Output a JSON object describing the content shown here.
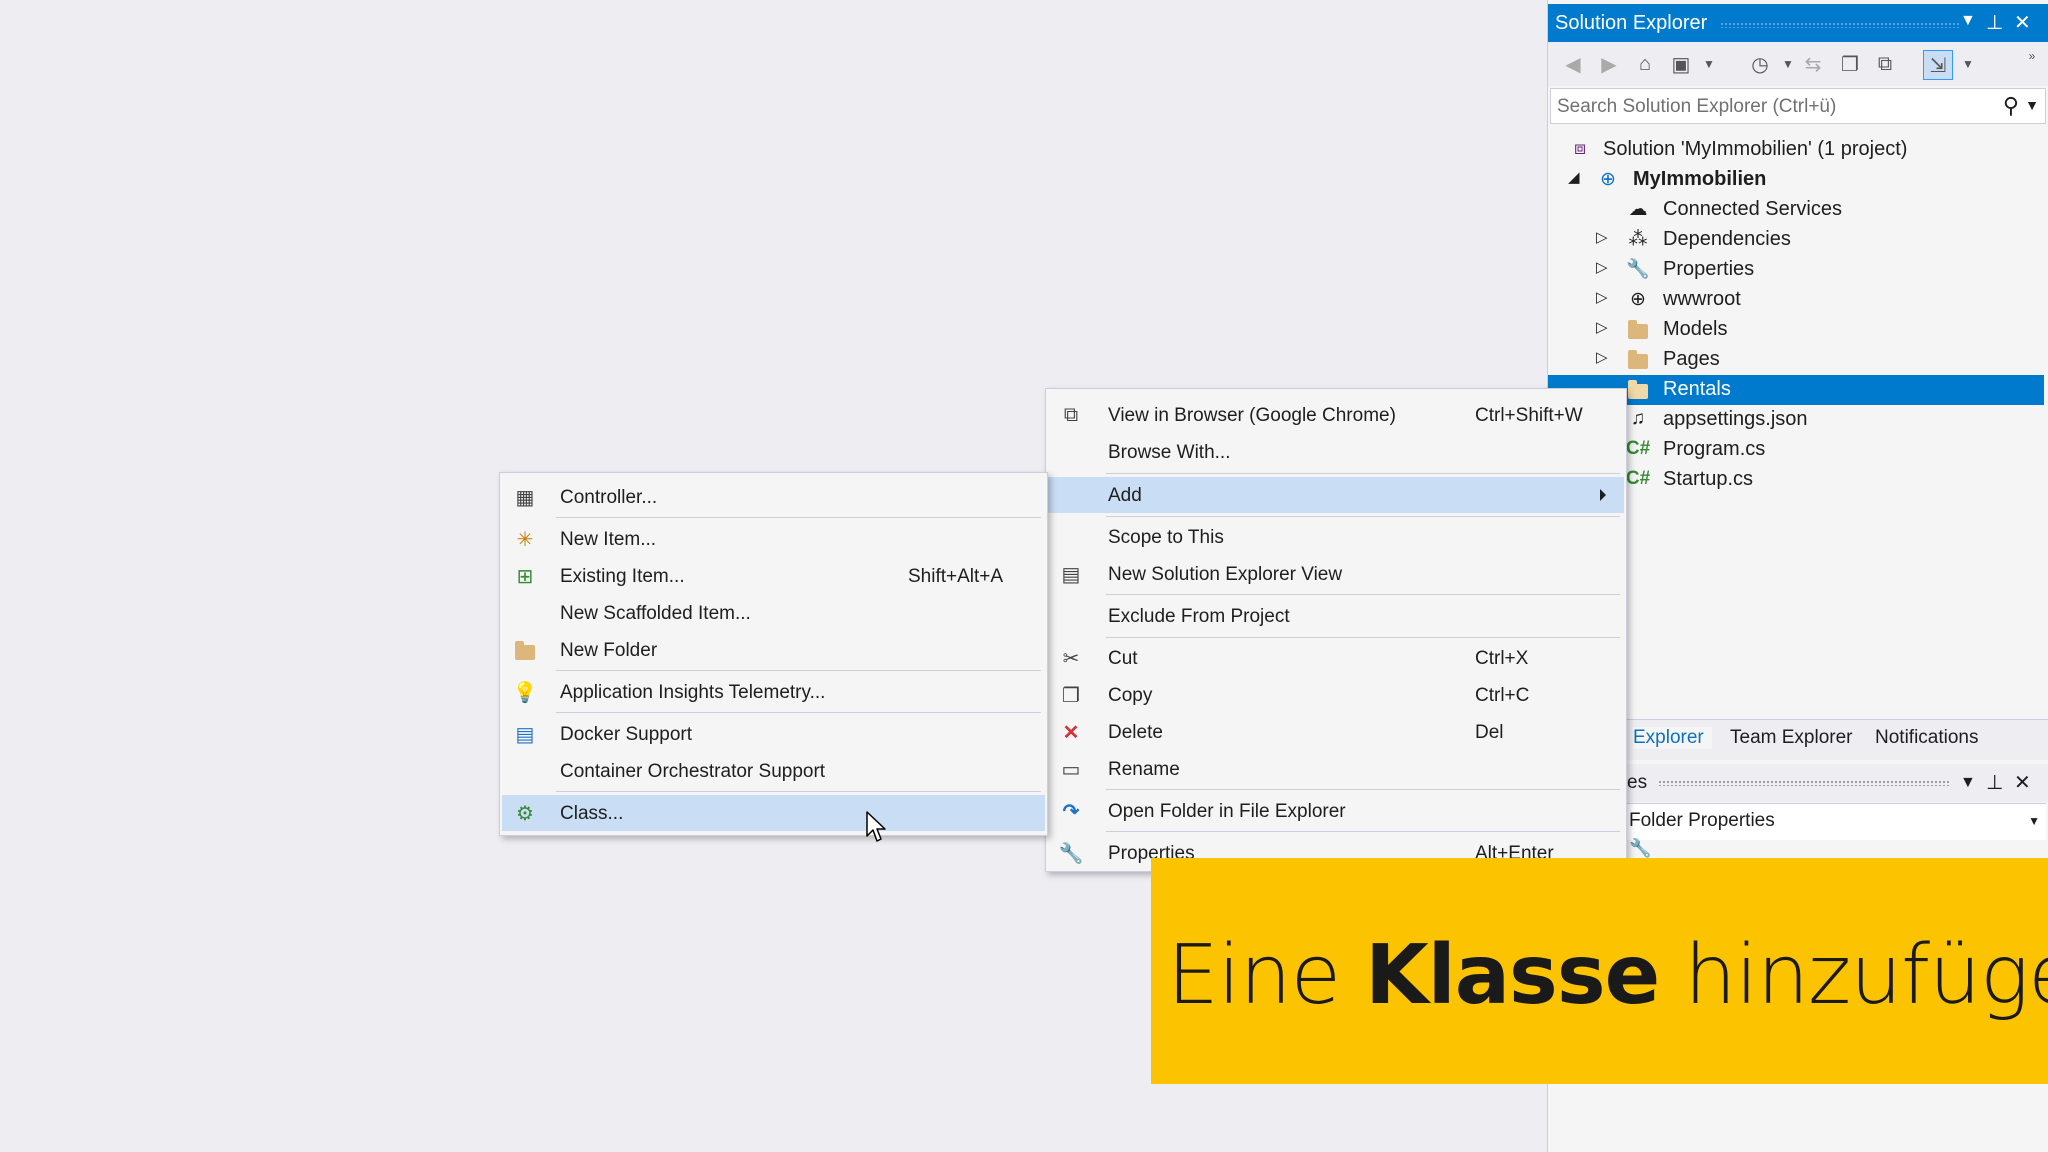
{
  "solution_explorer": {
    "title": "Solution Explorer",
    "search_placeholder": "Search Solution Explorer (Ctrl+ü)",
    "tree": [
      {
        "label": "Solution 'MyImmobilien' (1 project)",
        "icon": "solution-icon"
      },
      {
        "label": "MyImmobilien",
        "icon": "web-project-icon",
        "bold": true,
        "expanded": true
      },
      {
        "label": "Connected Services",
        "icon": "connected-services-icon"
      },
      {
        "label": "Dependencies",
        "icon": "dependencies-icon"
      },
      {
        "label": "Properties",
        "icon": "wrench-icon"
      },
      {
        "label": "wwwroot",
        "icon": "globe-icon"
      },
      {
        "label": "Models",
        "icon": "folder-icon"
      },
      {
        "label": "Pages",
        "icon": "folder-icon"
      },
      {
        "label": "Rentals",
        "icon": "folder-icon",
        "selected": true
      },
      {
        "label": "appsettings.json",
        "icon": "json-icon"
      },
      {
        "label": "Program.cs",
        "icon": "csharp-icon"
      },
      {
        "label": "Startup.cs",
        "icon": "csharp-icon"
      }
    ],
    "tabs": [
      "Explorer",
      "Team Explorer",
      "Notifications"
    ],
    "properties_title_fragment": "es",
    "properties_combo": "Folder Properties"
  },
  "context_menu": {
    "items": [
      {
        "label": "View in Browser (Google Chrome)",
        "shortcut": "Ctrl+Shift+W",
        "icon": "view-in-browser-icon"
      },
      {
        "label": "Browse With...",
        "shortcut": ""
      },
      {
        "label": "Add",
        "shortcut": "",
        "submenu": true,
        "highlighted": true
      },
      {
        "label": "Scope to This",
        "shortcut": ""
      },
      {
        "label": "New Solution Explorer View",
        "shortcut": "",
        "icon": "new-view-icon"
      },
      {
        "label": "Exclude From Project",
        "shortcut": ""
      },
      {
        "label": "Cut",
        "shortcut": "Ctrl+X",
        "icon": "scissors-icon"
      },
      {
        "label": "Copy",
        "shortcut": "Ctrl+C",
        "icon": "copy-icon"
      },
      {
        "label": "Delete",
        "shortcut": "Del",
        "icon": "delete-icon"
      },
      {
        "label": "Rename",
        "shortcut": "",
        "icon": "rename-icon"
      },
      {
        "label": "Open Folder in File Explorer",
        "shortcut": "",
        "icon": "refresh-arrow-icon"
      },
      {
        "label": "Properties",
        "shortcut": "Alt+Enter",
        "icon": "wrench-icon"
      }
    ]
  },
  "add_submenu": {
    "items": [
      {
        "label": "Controller...",
        "shortcut": "",
        "icon": "controller-icon"
      },
      {
        "label": "New Item...",
        "shortcut": "",
        "icon": "new-item-icon"
      },
      {
        "label": "Existing Item...",
        "shortcut": "Shift+Alt+A",
        "icon": "existing-item-icon"
      },
      {
        "label": "New Scaffolded Item...",
        "shortcut": ""
      },
      {
        "label": "New Folder",
        "shortcut": "",
        "icon": "new-folder-icon"
      },
      {
        "label": "Application Insights Telemetry...",
        "shortcut": "",
        "icon": "app-insights-icon"
      },
      {
        "label": "Docker Support",
        "shortcut": "",
        "icon": "docker-icon"
      },
      {
        "label": "Container Orchestrator Support",
        "shortcut": ""
      },
      {
        "label": "Class...",
        "shortcut": "",
        "icon": "class-icon",
        "highlighted": true
      }
    ]
  },
  "caption": {
    "before": "Eine ",
    "bold": "Klasse",
    "after": " hinzufügen"
  },
  "colors": {
    "accent": "#007acc",
    "menu_highlight": "#c9def5",
    "caption_bg": "#fcc400"
  }
}
